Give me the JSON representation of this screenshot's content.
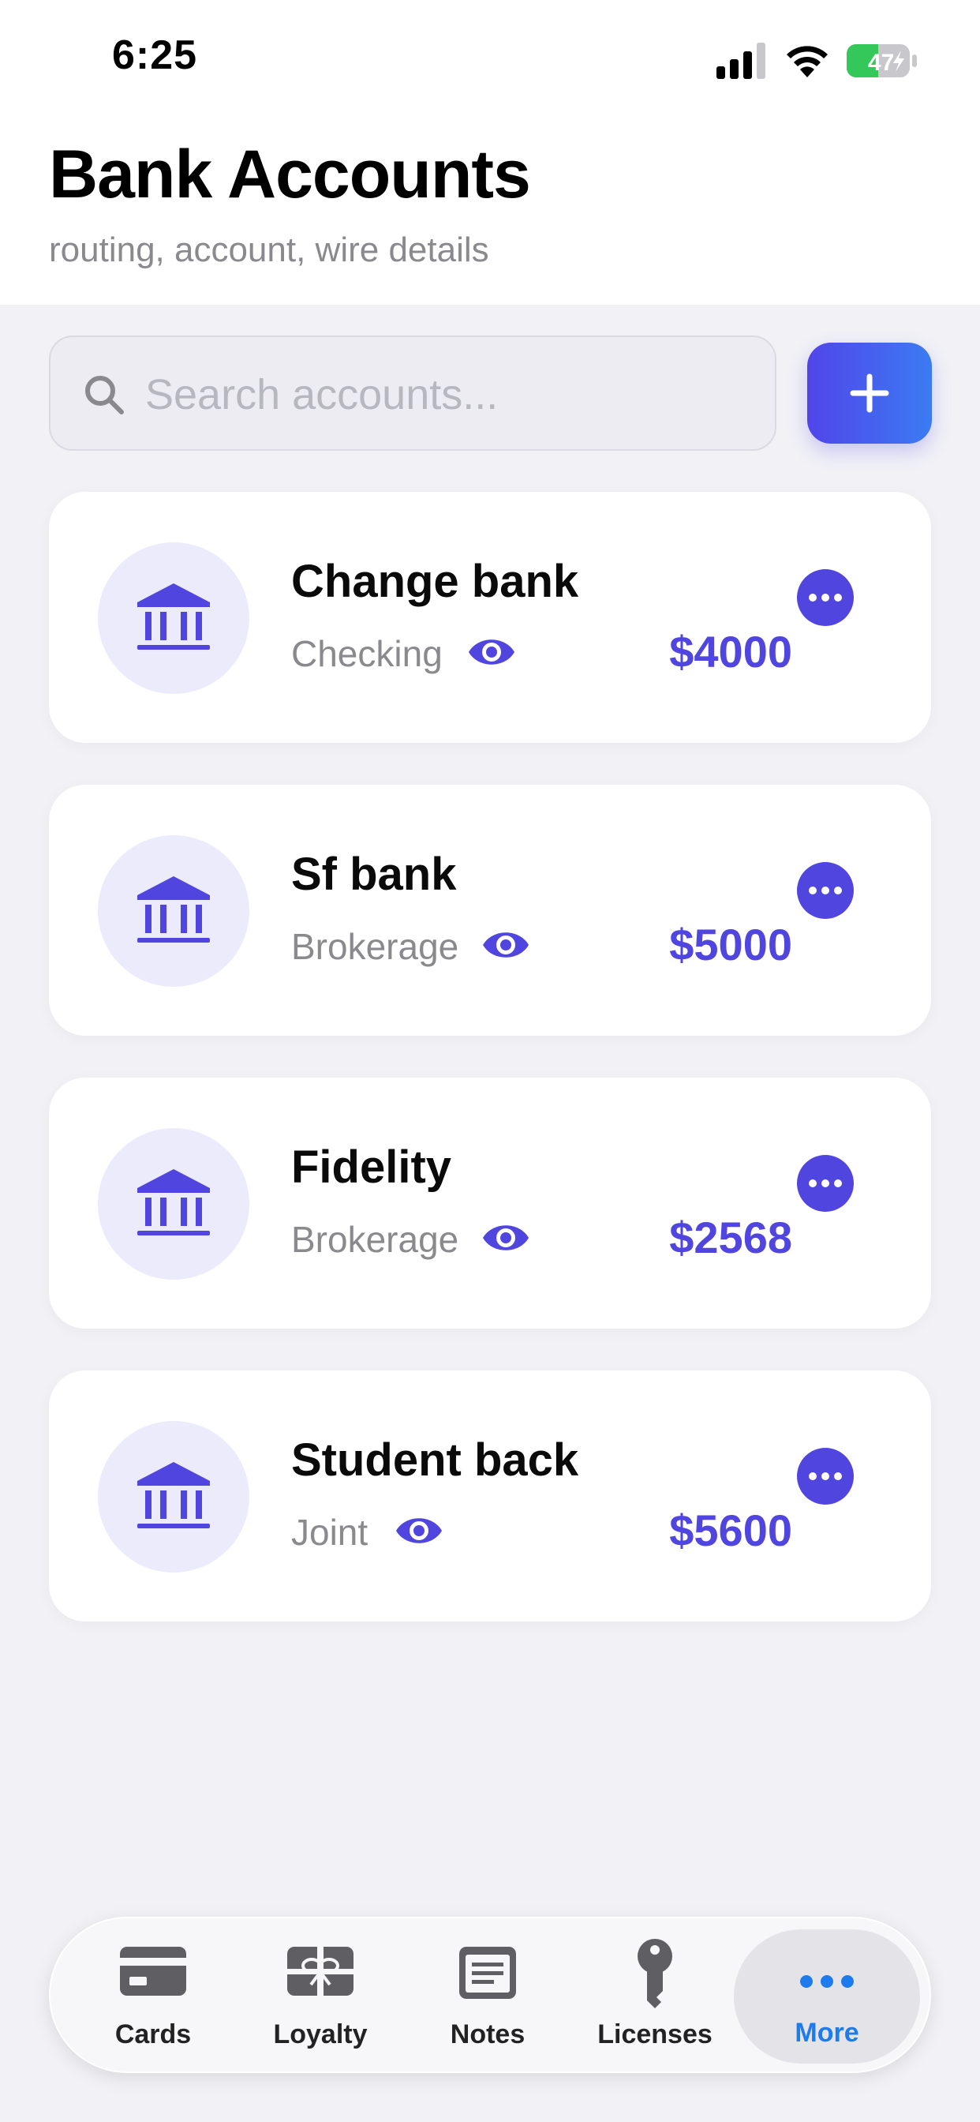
{
  "status_bar": {
    "time": "6:25",
    "battery": "47"
  },
  "header": {
    "title": "Bank Accounts",
    "subtitle": "routing, account, wire details"
  },
  "search": {
    "placeholder": "Search accounts...",
    "value": ""
  },
  "colors": {
    "accent": "#5145E0",
    "gradient_end": "#3B7BF2",
    "background": "#F1F1F6",
    "active_tab": "#1E7BEE"
  },
  "accounts": [
    {
      "name": "Change bank",
      "type": "Checking",
      "amount": "$4000",
      "icon": "bank-icon"
    },
    {
      "name": "Sf bank",
      "type": "Brokerage",
      "amount": "$5000",
      "icon": "bank-icon"
    },
    {
      "name": "Fidelity",
      "type": "Brokerage",
      "amount": "$2568",
      "icon": "bank-icon"
    },
    {
      "name": "Student back",
      "type": "Joint",
      "amount": "$5600",
      "icon": "bank-icon"
    }
  ],
  "tabbar": {
    "items": [
      {
        "label": "Cards",
        "icon": "card-icon"
      },
      {
        "label": "Loyalty",
        "icon": "gift-icon"
      },
      {
        "label": "Notes",
        "icon": "note-icon"
      },
      {
        "label": "Licenses",
        "icon": "key-icon"
      },
      {
        "label": "More",
        "icon": "ellipsis-icon",
        "active": true
      }
    ]
  }
}
